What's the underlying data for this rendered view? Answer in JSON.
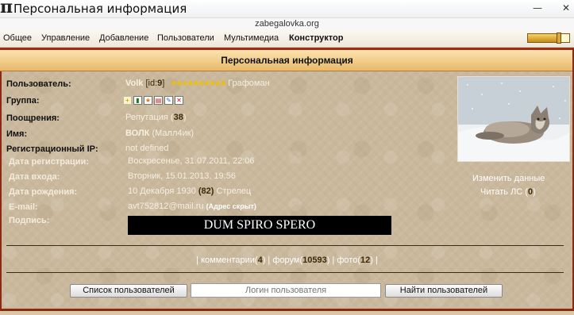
{
  "window": {
    "icon_glyph": "π",
    "title": "Персональная информация",
    "min_glyph": "—",
    "close_glyph": "✕"
  },
  "url": "zabegalovka.org",
  "nav": {
    "items": [
      "Общее",
      "Управление",
      "Добавление",
      "Пользователи",
      "Мультимедиа"
    ],
    "active": "Конструктор",
    "slider_level": 0.75
  },
  "panel": {
    "header": "Персональная информация"
  },
  "profile": {
    "user_label": "Пользователь:",
    "username": "Volk",
    "id_prefix": "[id:",
    "id_value": "9",
    "id_suffix": "]",
    "stars": "★★★★★★★★★★",
    "rank": "Графоман",
    "group_label": "Группа:",
    "rewards_label": "Поощрения:",
    "reputation_text": "Репутация (",
    "reputation_value": "38",
    "reputation_close": ")",
    "name_label": "Имя:",
    "name_value": "ВОЛК",
    "name_extra": "(Малл4ик)",
    "regip_label": "Регистрационный IP:",
    "regip_value": "not defined",
    "regdate_label": "Дата регистрации:",
    "regdate_value": "Воскресенье, 31.07.2011, 22:06",
    "login_label": "Дата входа:",
    "login_value": "Вторник, 15.01.2013, 19:56",
    "birth_label": "Дата рождения:",
    "birth_value": "10 Декабря 1930",
    "birth_age": "(82)",
    "birth_sign": "Стрелец",
    "email_label": "E-mail:",
    "email_value": "avt752812@mail.ru",
    "email_hidden": "(Адрес скрыт)",
    "signature_label": "Подпись:",
    "signature_text": "DUM SPIRO SPERO"
  },
  "avatar_links": {
    "edit": "Изменить данные",
    "pm_text": "Читать ЛС (",
    "pm_count": "0",
    "pm_close": ")"
  },
  "stats": {
    "comments_label": "комментарии(",
    "comments_count": "4",
    "forum_label": "форум(",
    "forum_count": "10593",
    "photos_label": "фото(",
    "photos_count": "12"
  },
  "search": {
    "users_list_button": "Список пользователей",
    "placeholder": "Логин пользователя",
    "find_button": "Найти пользователей"
  },
  "colors": {
    "accent": "#8a2a14",
    "header_bg": "#f0c97e",
    "stars": "#f0c000"
  }
}
